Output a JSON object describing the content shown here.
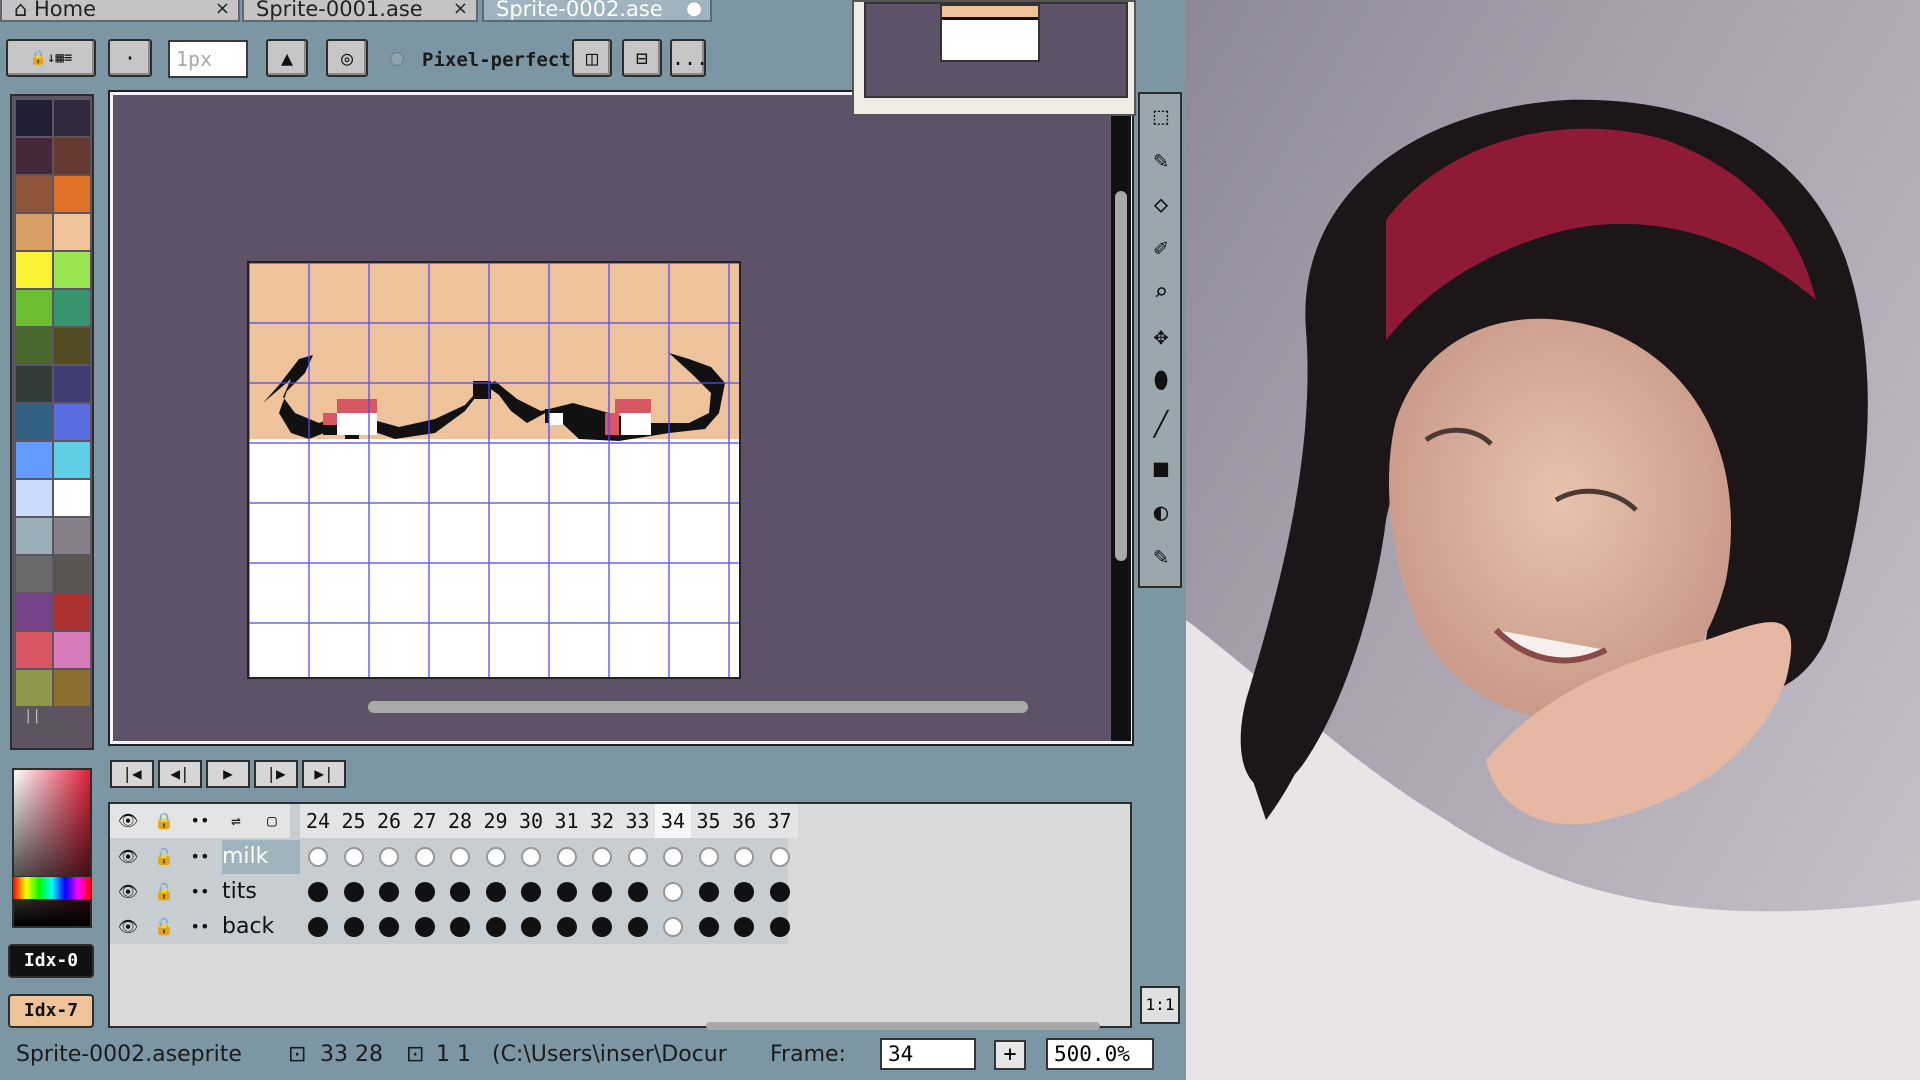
{
  "tabs": [
    {
      "label": "Home",
      "close": "×"
    },
    {
      "label": "Sprite-0001.ase",
      "close": "×"
    },
    {
      "label": "Sprite-0002.ase",
      "close": "●"
    }
  ],
  "toolbar": {
    "brush_size_value": "1px",
    "pixel_perfect_label": "Pixel-perfect",
    "more_label": "...",
    "dot_label": "·"
  },
  "palette": {
    "colors": [
      "#222034",
      "#2f2a3d",
      "#45283c",
      "#663931",
      "#8f563b",
      "#df7126",
      "#d9a066",
      "#eec39a",
      "#fbf236",
      "#99e550",
      "#6abe30",
      "#37946e",
      "#4b692f",
      "#524b24",
      "#323c39",
      "#3f3f74",
      "#306082",
      "#5b6ee1",
      "#639bff",
      "#5fcde4",
      "#cbdbfc",
      "#ffffff",
      "#9badb7",
      "#847e87",
      "#696a6a",
      "#595652",
      "#76428a",
      "#ac3232",
      "#d95763",
      "#d77bba",
      "#8f974a",
      "#8a6f30"
    ],
    "pause_glyph": "||"
  },
  "idx": {
    "fg": "Idx-0",
    "bg": "Idx-7"
  },
  "tools": [
    "⬚",
    "✎",
    "◇",
    "✐",
    "⌕",
    "✥",
    "⬮",
    "╱",
    "■",
    "◐",
    "✎"
  ],
  "one_to_one": "1:1",
  "playback": [
    "|◀",
    "◀|",
    "▶",
    "|▶",
    "▶|"
  ],
  "timeline": {
    "header_icons": [
      "👁",
      "🔒",
      "••",
      "⇌",
      "▢"
    ],
    "frames": [
      "24",
      "25",
      "26",
      "27",
      "28",
      "29",
      "30",
      "31",
      "32",
      "33",
      "34",
      "35",
      "36",
      "37"
    ],
    "current_frame": "34",
    "layers": [
      {
        "name": "milk",
        "cels": "empty"
      },
      {
        "name": "tits",
        "cels": "filled"
      },
      {
        "name": "back",
        "cels": "filled"
      }
    ]
  },
  "status": {
    "filename": "Sprite-0002.aseprite",
    "size": "33 28",
    "grid": "1 1",
    "path": "(C:\\Users\\inser\\Docur",
    "frame_label": "Frame:",
    "frame_value": "34",
    "plus": "+",
    "zoom": "500.0%"
  }
}
